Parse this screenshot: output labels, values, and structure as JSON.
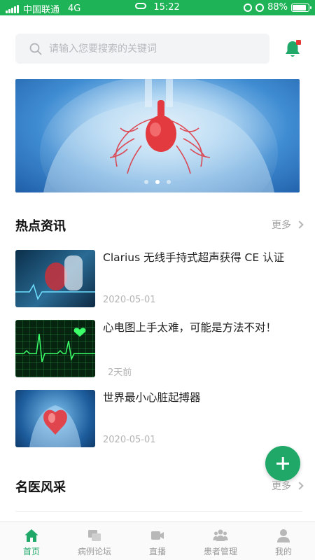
{
  "status_bar": {
    "carrier": "中国联通",
    "network": "4G",
    "time": "15:22",
    "battery": "88%",
    "battery_level": 0.88
  },
  "search": {
    "placeholder": "请输入您要搜索的关键词"
  },
  "colors": {
    "brand": "#1fa868",
    "status_bar": "#1fb357",
    "notification_dot": "#e53935"
  },
  "banner": {
    "slide_count": 3,
    "active_slide": 2
  },
  "hot_news": {
    "title": "热点资讯",
    "more": "更多",
    "items": [
      {
        "title": "Clarius 无线手持式超声获得 CE 认证",
        "date": "2020-05-01",
        "thumb": "ultrasound-image"
      },
      {
        "title": "心电图上手太难，可能是方法不对！",
        "date": "2天前",
        "thumb": "ecg-image"
      },
      {
        "title": "世界最小心脏起搏器",
        "date": "2020-05-01",
        "thumb": "heart-xray-image"
      }
    ]
  },
  "famous_doctors": {
    "title": "名医风采",
    "more": "更多"
  },
  "tabbar": {
    "items": [
      {
        "label": "首页",
        "icon": "home-icon",
        "active": true
      },
      {
        "label": "病例论坛",
        "icon": "forum-icon",
        "active": false
      },
      {
        "label": "直播",
        "icon": "video-icon",
        "active": false
      },
      {
        "label": "患者管理",
        "icon": "patients-icon",
        "active": false
      },
      {
        "label": "我的",
        "icon": "profile-icon",
        "active": false
      }
    ]
  }
}
